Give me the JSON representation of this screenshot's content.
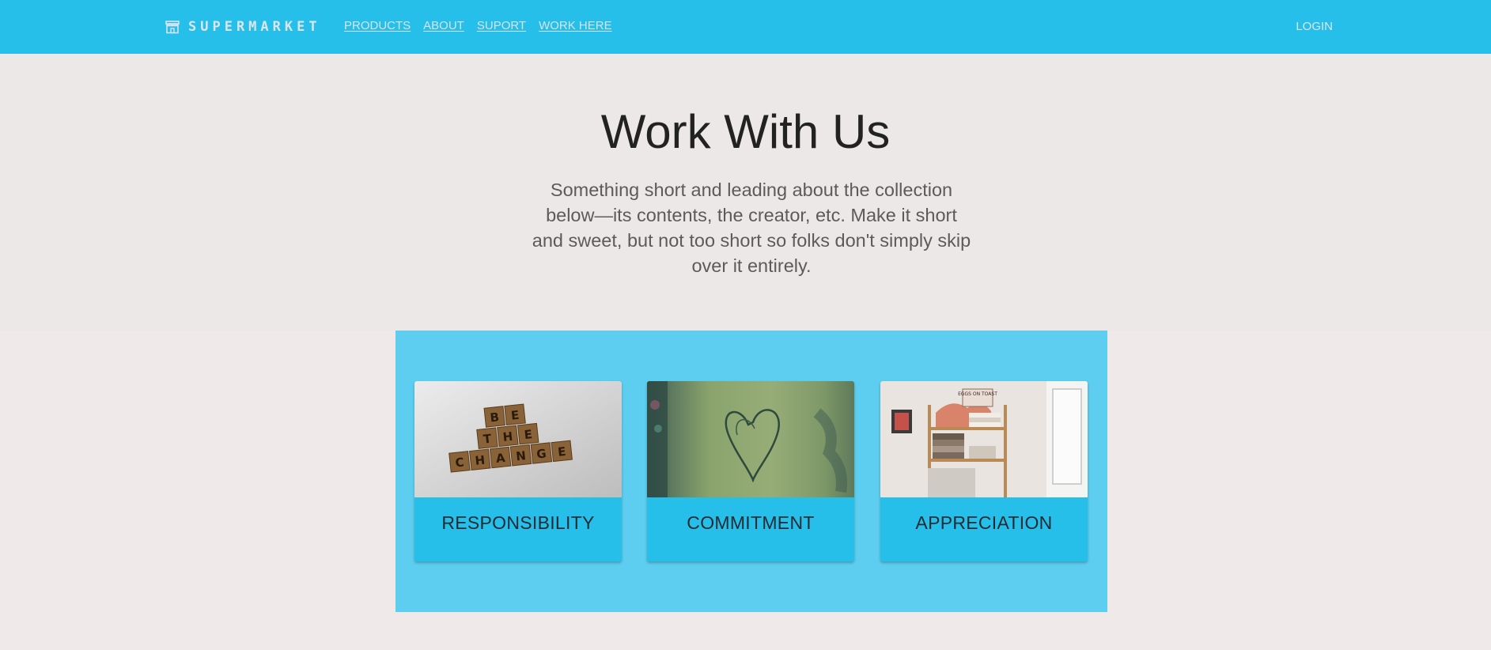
{
  "nav": {
    "brand": "SUPERMARKET",
    "brand_icon": "store-icon",
    "links": [
      "PRODUCTS",
      "ABOUT",
      "SUPORT",
      "WORK HERE"
    ],
    "login": "LOGIN"
  },
  "hero": {
    "title": "Work With Us",
    "lead": "Something short and leading about the collection below—its contents, the creator, etc. Make it short and sweet, but not too short so folks don't simply skip over it entirely."
  },
  "cards": [
    {
      "label": "RESPONSIBILITY",
      "image": "scrabble-tiles-photo",
      "tiles": [
        "B",
        "E",
        "T",
        "H",
        "E",
        "C",
        "H",
        "A",
        "N",
        "G",
        "E"
      ]
    },
    {
      "label": "COMMITMENT",
      "image": "heart-carved-tree-photo"
    },
    {
      "label": "APPRECIATION",
      "image": "bookshelf-room-photo",
      "book_text": "EGGS ON TOAST"
    }
  ],
  "colors": {
    "nav_bg": "#25bfe9",
    "page_bg": "#efe9e9",
    "band_bg": "#5dceef",
    "card_bg": "#25bfe9"
  }
}
